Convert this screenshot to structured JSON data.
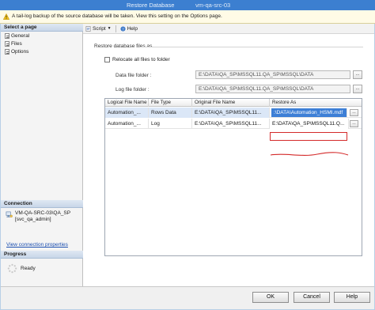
{
  "window": {
    "title_left": "Restore Database",
    "title_right": "vm-qa-src-03"
  },
  "banner": {
    "text": "A tail-log backup of the source database will be taken. View this setting on the Options page."
  },
  "sidebar": {
    "select_page_heading": "Select a page",
    "pages": [
      {
        "label": "General"
      },
      {
        "label": "Files"
      },
      {
        "label": "Options"
      }
    ],
    "connection_heading": "Connection",
    "connection_server": "VM-QA-SRC-03\\QA_SP",
    "connection_user": "[svc_qa_admin]",
    "view_connection_link": "View connection properties",
    "progress_heading": "Progress",
    "progress_status": "Ready"
  },
  "toolbar": {
    "script_label": "Script",
    "help_label": "Help"
  },
  "files": {
    "group_label": "Restore database files as",
    "relocate_label": "Relocate all files to folder",
    "relocate_checked": false,
    "data_folder_label": "Data file folder :",
    "data_folder_value": "E:\\DATA\\QA_SP\\MSSQL11.QA_SP\\MSSQL\\DATA",
    "log_folder_label": "Log file folder :",
    "log_folder_value": "E:\\DATA\\QA_SP\\MSSQL11.QA_SP\\MSSQL\\DATA",
    "browse_label": "..."
  },
  "grid": {
    "columns": [
      "Logical File Name",
      "File Type",
      "Original File Name",
      "Restore As"
    ],
    "rows": [
      {
        "logical": "Automation_...",
        "type": "Rows Data",
        "original": "E:\\DATA\\QA_SP\\MSSQL11...",
        "restore_as": ":\\DATA\\Automation_HSMI.mdf"
      },
      {
        "logical": "Automation_...",
        "type": "Log",
        "original": "E:\\DATA\\QA_SP\\MSSQL11...",
        "restore_as": "E:\\DATA\\QA_SP\\MSSQL11.Q..."
      }
    ],
    "cell_button_label": "..."
  },
  "footer": {
    "ok_label": "OK",
    "cancel_label": "Cancel",
    "help_label": "Help"
  },
  "colors": {
    "titlebar": "#3c7fd0",
    "selection": "#3d7fd6",
    "annotation": "#d42a2a"
  }
}
